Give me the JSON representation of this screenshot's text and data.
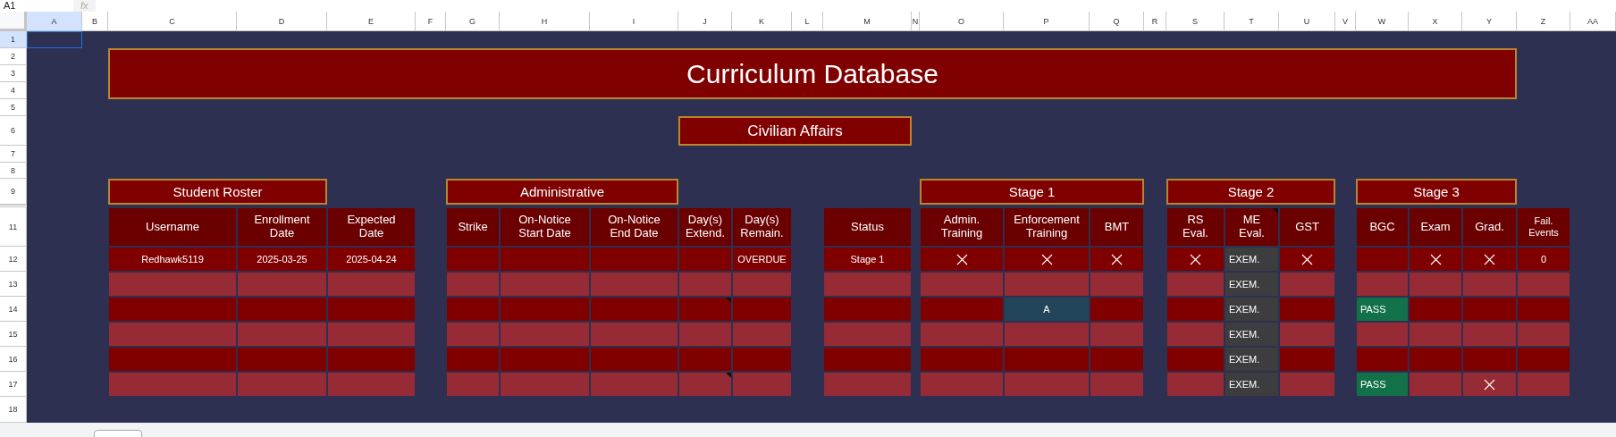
{
  "toolbar": {
    "name_box": "A1",
    "formula_label": "fx"
  },
  "column_headers": [
    {
      "label": "A",
      "selected": true
    },
    {
      "label": "B",
      "selected": false
    },
    {
      "label": "C",
      "selected": false
    },
    {
      "label": "D",
      "selected": false
    },
    {
      "label": "E",
      "selected": false
    },
    {
      "label": "F",
      "selected": false
    },
    {
      "label": "G",
      "selected": false
    },
    {
      "label": "H",
      "selected": false
    },
    {
      "label": "I",
      "selected": false
    },
    {
      "label": "J",
      "selected": false
    },
    {
      "label": "K",
      "selected": false
    },
    {
      "label": "L",
      "selected": false
    },
    {
      "label": "M",
      "selected": false
    },
    {
      "label": "N",
      "selected": false
    },
    {
      "label": "O",
      "selected": false
    },
    {
      "label": "P",
      "selected": false
    },
    {
      "label": "Q",
      "selected": false
    },
    {
      "label": "R",
      "selected": false
    },
    {
      "label": "S",
      "selected": false
    },
    {
      "label": "T",
      "selected": false
    },
    {
      "label": "U",
      "selected": false
    },
    {
      "label": "V",
      "selected": false
    },
    {
      "label": "W",
      "selected": false
    },
    {
      "label": "X",
      "selected": false
    },
    {
      "label": "Y",
      "selected": false
    },
    {
      "label": "Z",
      "selected": false
    },
    {
      "label": "AA",
      "selected": false
    }
  ],
  "row_headers": [
    {
      "label": "1",
      "selected": true
    },
    {
      "label": "2",
      "selected": false
    },
    {
      "label": "3",
      "selected": false
    },
    {
      "label": "4",
      "selected": false
    },
    {
      "label": "5",
      "selected": false
    },
    {
      "label": "6",
      "selected": false
    },
    {
      "label": "7",
      "selected": false
    },
    {
      "label": "8",
      "selected": false
    },
    {
      "label": "9",
      "selected": false
    },
    {
      "label": "11",
      "selected": false
    },
    {
      "label": "12",
      "selected": false
    },
    {
      "label": "13",
      "selected": false
    },
    {
      "label": "14",
      "selected": false
    },
    {
      "label": "15",
      "selected": false
    },
    {
      "label": "16",
      "selected": false
    },
    {
      "label": "17",
      "selected": false
    },
    {
      "label": "18",
      "selected": false
    }
  ],
  "title": "Curriculum Database",
  "subtitle": "Civilian Affairs",
  "section_headers": [
    "Student Roster",
    "Administrative",
    "Stage 1",
    "Stage 2",
    "Stage 3"
  ],
  "columns": [
    {
      "label": "Username",
      "note": false
    },
    {
      "label": "Enrollment Date",
      "note": false
    },
    {
      "label": "Expected Date",
      "note": false
    },
    {
      "label": "Strike",
      "note": false
    },
    {
      "label": "On-Notice Start Date",
      "note": false
    },
    {
      "label": "On-Notice End Date",
      "note": false
    },
    {
      "label": "Day(s) Extend.",
      "note": false
    },
    {
      "label": "Day(s) Remain.",
      "note": false
    },
    {
      "label": "Status",
      "note": false
    },
    {
      "label": "Admin. Training",
      "note": false
    },
    {
      "label": "Enforcement Training",
      "note": false
    },
    {
      "label": "BMT",
      "note": false
    },
    {
      "label": "RS Eval.",
      "note": false
    },
    {
      "label": "ME Eval.",
      "note": true
    },
    {
      "label": "GST",
      "note": false
    },
    {
      "label": "BGC",
      "note": false
    },
    {
      "label": "Exam",
      "note": false
    },
    {
      "label": "Grad.",
      "note": false
    },
    {
      "label": "Fail. Events",
      "note": false
    }
  ],
  "rows": [
    {
      "cells": [
        {
          "kind": "text",
          "text": "Redhawk5119"
        },
        {
          "kind": "text",
          "text": "2025-03-25"
        },
        {
          "kind": "text",
          "text": "2025-04-24"
        },
        {
          "kind": "empty"
        },
        {
          "kind": "empty"
        },
        {
          "kind": "empty"
        },
        {
          "kind": "empty"
        },
        {
          "kind": "text",
          "text": "OVERDUE"
        },
        {
          "kind": "text",
          "text": "Stage 1"
        },
        {
          "kind": "cross"
        },
        {
          "kind": "cross"
        },
        {
          "kind": "cross"
        },
        {
          "kind": "cross"
        },
        {
          "kind": "exempt",
          "text": "EXEM."
        },
        {
          "kind": "cross"
        },
        {
          "kind": "empty"
        },
        {
          "kind": "cross"
        },
        {
          "kind": "cross"
        },
        {
          "kind": "text",
          "text": "0"
        }
      ]
    },
    {
      "cells": [
        {
          "kind": "empty"
        },
        {
          "kind": "empty"
        },
        {
          "kind": "empty"
        },
        {
          "kind": "empty"
        },
        {
          "kind": "empty"
        },
        {
          "kind": "empty"
        },
        {
          "kind": "empty"
        },
        {
          "kind": "empty"
        },
        {
          "kind": "empty"
        },
        {
          "kind": "empty"
        },
        {
          "kind": "empty"
        },
        {
          "kind": "empty"
        },
        {
          "kind": "empty"
        },
        {
          "kind": "exempt",
          "text": "EXEM."
        },
        {
          "kind": "empty"
        },
        {
          "kind": "empty"
        },
        {
          "kind": "empty"
        },
        {
          "kind": "empty"
        },
        {
          "kind": "empty"
        }
      ]
    },
    {
      "cells": [
        {
          "kind": "empty"
        },
        {
          "kind": "empty"
        },
        {
          "kind": "empty"
        },
        {
          "kind": "empty"
        },
        {
          "kind": "empty"
        },
        {
          "kind": "empty"
        },
        {
          "kind": "empty",
          "note": true
        },
        {
          "kind": "empty"
        },
        {
          "kind": "empty"
        },
        {
          "kind": "empty"
        },
        {
          "kind": "highlight",
          "text": "A"
        },
        {
          "kind": "empty"
        },
        {
          "kind": "empty"
        },
        {
          "kind": "exempt",
          "text": "EXEM."
        },
        {
          "kind": "empty"
        },
        {
          "kind": "pass",
          "text": "PASS"
        },
        {
          "kind": "empty"
        },
        {
          "kind": "empty"
        },
        {
          "kind": "empty"
        }
      ]
    },
    {
      "cells": [
        {
          "kind": "empty"
        },
        {
          "kind": "empty"
        },
        {
          "kind": "empty"
        },
        {
          "kind": "empty"
        },
        {
          "kind": "empty"
        },
        {
          "kind": "empty"
        },
        {
          "kind": "empty"
        },
        {
          "kind": "empty"
        },
        {
          "kind": "empty"
        },
        {
          "kind": "empty"
        },
        {
          "kind": "empty"
        },
        {
          "kind": "empty"
        },
        {
          "kind": "empty"
        },
        {
          "kind": "exempt",
          "text": "EXEM."
        },
        {
          "kind": "empty"
        },
        {
          "kind": "empty"
        },
        {
          "kind": "empty"
        },
        {
          "kind": "empty"
        },
        {
          "kind": "empty"
        }
      ]
    },
    {
      "cells": [
        {
          "kind": "empty"
        },
        {
          "kind": "empty"
        },
        {
          "kind": "empty"
        },
        {
          "kind": "empty"
        },
        {
          "kind": "empty"
        },
        {
          "kind": "empty"
        },
        {
          "kind": "empty"
        },
        {
          "kind": "empty"
        },
        {
          "kind": "empty"
        },
        {
          "kind": "empty"
        },
        {
          "kind": "empty"
        },
        {
          "kind": "empty"
        },
        {
          "kind": "empty"
        },
        {
          "kind": "exempt",
          "text": "EXEM."
        },
        {
          "kind": "empty"
        },
        {
          "kind": "empty"
        },
        {
          "kind": "empty"
        },
        {
          "kind": "empty"
        },
        {
          "kind": "empty"
        }
      ]
    },
    {
      "cells": [
        {
          "kind": "empty"
        },
        {
          "kind": "empty"
        },
        {
          "kind": "empty"
        },
        {
          "kind": "empty"
        },
        {
          "kind": "empty"
        },
        {
          "kind": "empty"
        },
        {
          "kind": "empty",
          "note": true
        },
        {
          "kind": "empty"
        },
        {
          "kind": "empty"
        },
        {
          "kind": "empty"
        },
        {
          "kind": "empty"
        },
        {
          "kind": "empty"
        },
        {
          "kind": "empty"
        },
        {
          "kind": "exempt",
          "text": "EXEM."
        },
        {
          "kind": "empty"
        },
        {
          "kind": "pass",
          "text": "PASS"
        },
        {
          "kind": "empty"
        },
        {
          "kind": "cross"
        },
        {
          "kind": "empty"
        }
      ]
    }
  ]
}
